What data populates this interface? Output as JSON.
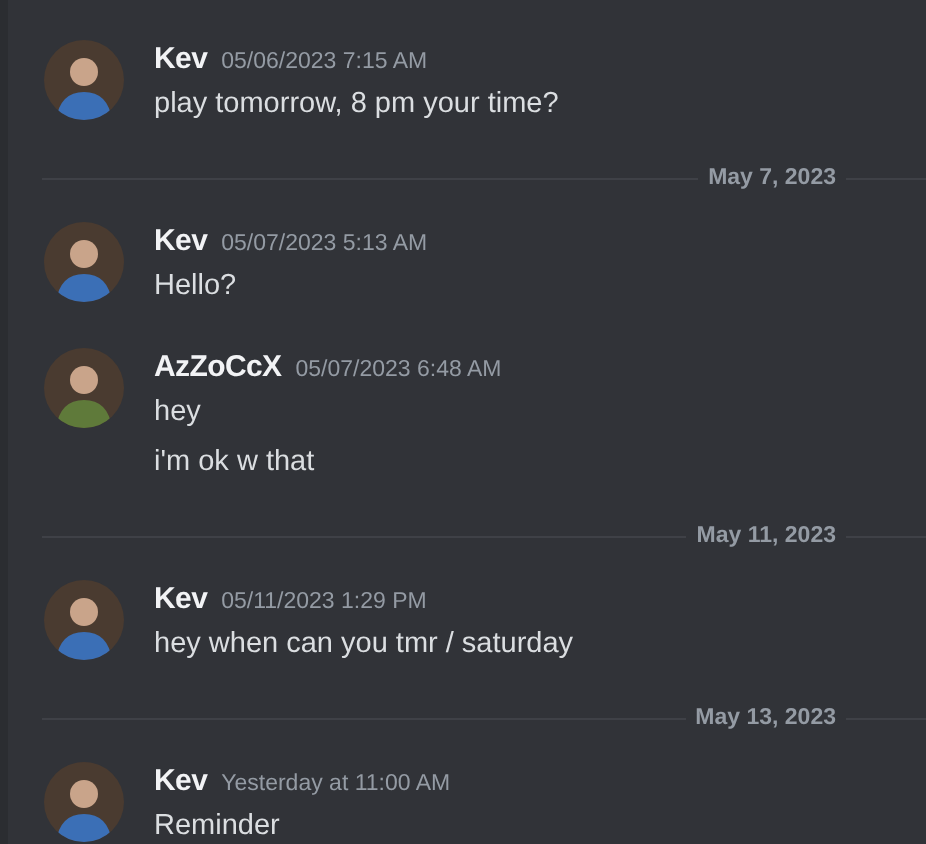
{
  "feed": [
    {
      "kind": "message",
      "author": "Kev",
      "timestamp": "05/06/2023 7:15 AM",
      "color": "#3b6fb6",
      "lines": [
        "play tomorrow, 8 pm your time?"
      ]
    },
    {
      "kind": "divider",
      "label": "May 7, 2023"
    },
    {
      "kind": "message",
      "author": "Kev",
      "timestamp": "05/07/2023 5:13 AM",
      "color": "#3b6fb6",
      "lines": [
        "Hello?"
      ]
    },
    {
      "kind": "message",
      "author": "AzZoCcX",
      "timestamp": "05/07/2023 6:48 AM",
      "color": "#5f7a3a",
      "lines": [
        "hey",
        "i'm ok w that"
      ]
    },
    {
      "kind": "divider",
      "label": "May 11, 2023"
    },
    {
      "kind": "message",
      "author": "Kev",
      "timestamp": "05/11/2023 1:29 PM",
      "color": "#3b6fb6",
      "lines": [
        "hey when can you tmr / saturday"
      ]
    },
    {
      "kind": "divider",
      "label": "May 13, 2023"
    },
    {
      "kind": "message",
      "author": "Kev",
      "timestamp": "Yesterday at 11:00 AM",
      "color": "#3b6fb6",
      "lines": [
        "Reminder"
      ]
    }
  ]
}
